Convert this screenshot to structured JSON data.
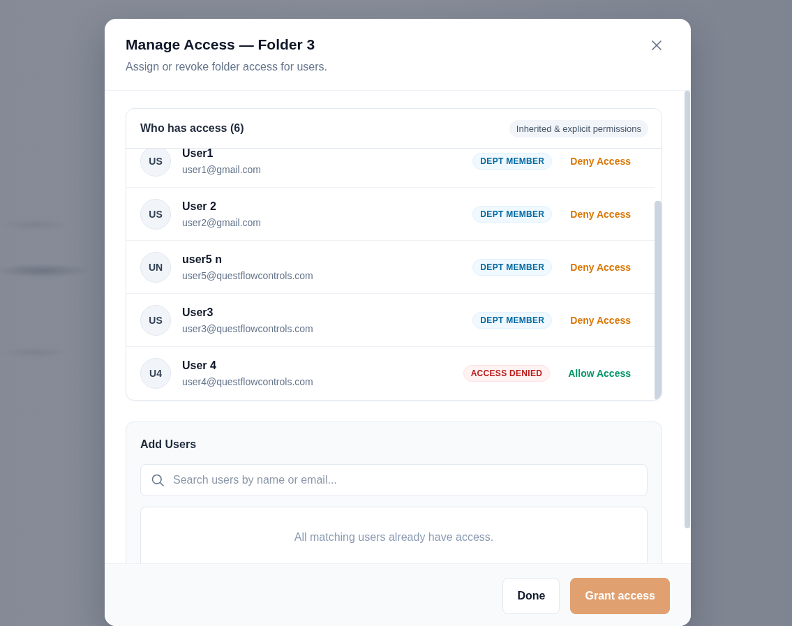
{
  "dialog": {
    "title": "Manage Access — Folder 3",
    "subtitle": "Assign or revoke folder access for users."
  },
  "access_list": {
    "title": "Who has access (6)",
    "chip": "Inherited & explicit permissions",
    "users": [
      {
        "initials": "US",
        "name": "User1",
        "email": "user1@gmail.com",
        "badge": "DEPT MEMBER",
        "denied": false,
        "action": "Deny Access"
      },
      {
        "initials": "US",
        "name": "User 2",
        "email": "user2@gmail.com",
        "badge": "DEPT MEMBER",
        "denied": false,
        "action": "Deny Access"
      },
      {
        "initials": "UN",
        "name": "user5 n",
        "email": "user5@questflowcontrols.com",
        "badge": "DEPT MEMBER",
        "denied": false,
        "action": "Deny Access"
      },
      {
        "initials": "US",
        "name": "User3",
        "email": "user3@questflowcontrols.com",
        "badge": "DEPT MEMBER",
        "denied": false,
        "action": "Deny Access"
      },
      {
        "initials": "U4",
        "name": "User 4",
        "email": "user4@questflowcontrols.com",
        "badge": "ACCESS DENIED",
        "denied": true,
        "action": "Allow Access"
      }
    ]
  },
  "add_users": {
    "title": "Add Users",
    "search": {
      "placeholder": "Search users by name or email..."
    },
    "empty_message": "All matching users already have access."
  },
  "footer": {
    "buttons": [
      {
        "label": "Done",
        "kind": "secondary",
        "disabled": false
      },
      {
        "label": "Grant access",
        "kind": "primary",
        "disabled": true
      }
    ]
  }
}
